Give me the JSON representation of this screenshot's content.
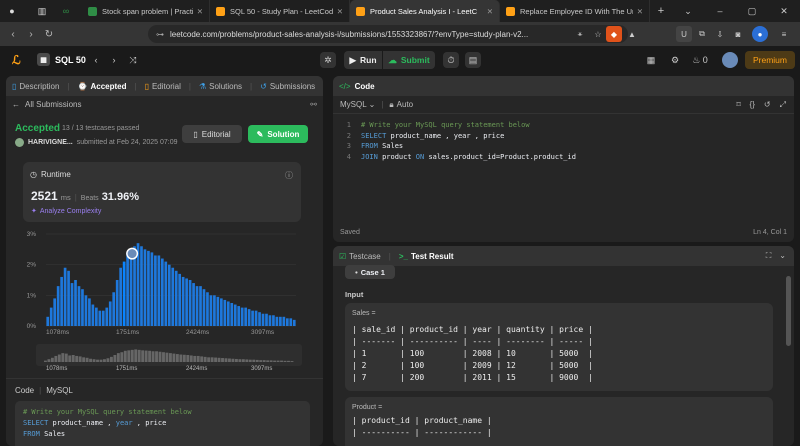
{
  "browser": {
    "tabs": [
      {
        "title": "Stock span problem | Practice | Gee",
        "fav": "#2f8d46"
      },
      {
        "title": "SQL 50 - Study Plan - LeetCode",
        "fav": "#ffa116"
      },
      {
        "title": "Product Sales Analysis I - LeetC",
        "fav": "#ffa116",
        "active": true
      },
      {
        "title": "Replace Employee ID With The Uni",
        "fav": "#ffa116"
      }
    ],
    "new_tab": "+",
    "url": "leetcode.com/problems/product-sales-analysis-i/submissions/1553323867/?envType=study-plan-v2...",
    "ext_badge": "U"
  },
  "header": {
    "plan": "SQL 50",
    "run": "Run",
    "submit": "Submit",
    "coins": "0",
    "premium": "Premium"
  },
  "left": {
    "tabs": [
      "Description",
      "Accepted",
      "Editorial",
      "Solutions",
      "Submissions"
    ],
    "all_submissions": "All Submissions",
    "status": "Accepted",
    "testcases": "13 / 13 testcases passed",
    "user": "HARIVIGNE...",
    "submitted": "submitted at Feb 24, 2025 07:09",
    "editorial_btn": "Editorial",
    "solution_btn": "Solution",
    "runtime_label": "Runtime",
    "runtime_value": "2521",
    "runtime_unit": "ms",
    "beats_label": "Beats",
    "beats_value": "31.96%",
    "analyze": "Analyze Complexity",
    "code_label": "Code",
    "lang_label": "MySQL",
    "code_lines": [
      "# Write your MySQL query statement below",
      "SELECT product_name , year , price",
      "FROM Sales"
    ]
  },
  "chart_data": {
    "type": "bar",
    "ylabels": [
      "3%",
      "2%",
      "1%",
      "0%"
    ],
    "xlabels": [
      "1078ms",
      "1751ms",
      "2424ms",
      "3097ms"
    ],
    "mini_xlabels": [
      "1078ms",
      "1751ms",
      "2424ms",
      "3097ms"
    ],
    "highlight_index": 22,
    "values": [
      0.3,
      0.6,
      0.9,
      1.3,
      1.6,
      1.9,
      1.8,
      1.4,
      1.5,
      1.3,
      1.2,
      1.0,
      0.9,
      0.7,
      0.6,
      0.5,
      0.5,
      0.6,
      0.8,
      1.1,
      1.5,
      1.9,
      2.1,
      2.4,
      2.5,
      2.6,
      2.7,
      2.6,
      2.5,
      2.45,
      2.4,
      2.3,
      2.3,
      2.2,
      2.1,
      2.0,
      1.9,
      1.8,
      1.7,
      1.6,
      1.55,
      1.5,
      1.4,
      1.3,
      1.3,
      1.2,
      1.1,
      1.0,
      1.0,
      0.95,
      0.9,
      0.85,
      0.8,
      0.75,
      0.7,
      0.65,
      0.6,
      0.6,
      0.55,
      0.5,
      0.5,
      0.45,
      0.4,
      0.4,
      0.35,
      0.35,
      0.3,
      0.3,
      0.3,
      0.25,
      0.25,
      0.2
    ],
    "ylim": [
      0,
      3
    ]
  },
  "code_panel": {
    "title": "Code",
    "lang": "MySQL",
    "auto": "Auto",
    "lines": [
      [
        "cm",
        "# Write your MySQL query statement below"
      ],
      [
        "kw",
        "SELECT",
        " product_name , year , price"
      ],
      [
        "kw",
        "FROM",
        " Sales"
      ],
      [
        "kw",
        "JOIN",
        " product ",
        "ON",
        " sales.product_id=Product.product_id"
      ]
    ],
    "line_numbers": [
      "1",
      "2",
      "3",
      "4"
    ],
    "saved": "Saved",
    "position": "Ln 4, Col 1"
  },
  "result_panel": {
    "tab1": "Testcase",
    "tab2": "Test Result",
    "case": "Case 1",
    "input_label": "Input",
    "sales_label": "Sales =",
    "sales_table": "| sale_id | product_id | year | quantity | price |\n| ------- | ---------- | ---- | -------- | ----- |\n| 1       | 100        | 2008 | 10       | 5000  |\n| 2       | 100        | 2009 | 12       | 5000  |\n| 7       | 200        | 2011 | 15       | 9000  |",
    "product_label": "Product =",
    "product_table": "| product_id | product_name |\n| ---------- | ------------ |"
  }
}
